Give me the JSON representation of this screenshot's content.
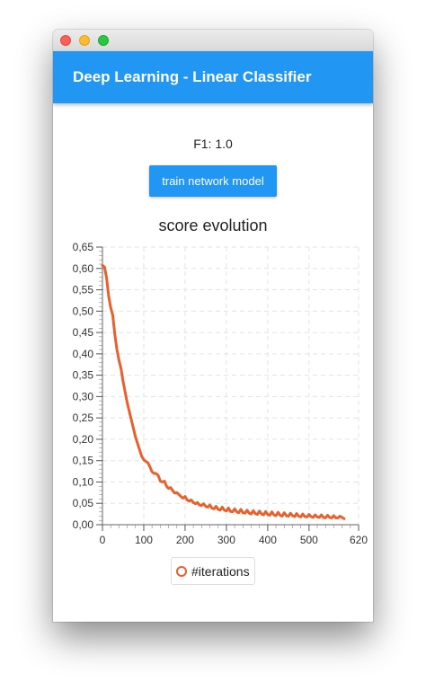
{
  "window": {
    "title": ""
  },
  "appbar": {
    "title": "Deep Learning - Linear Classifier"
  },
  "metric": {
    "f1_text": "F1: 1.0"
  },
  "actions": {
    "train_label": "train network model"
  },
  "colors": {
    "accent": "#2196f3",
    "series": "#e8612c",
    "grid": "#e3e3e3"
  },
  "chart_data": {
    "type": "line",
    "title": "score evolution",
    "xlabel": "",
    "ylabel": "",
    "xlim": [
      0,
      620
    ],
    "ylim": [
      0,
      0.65
    ],
    "x_ticks": [
      0,
      100,
      200,
      300,
      400,
      500,
      620
    ],
    "x_tick_labels": [
      "0",
      "100",
      "200",
      "300",
      "400",
      "500",
      "620"
    ],
    "y_ticks": [
      0,
      0.05,
      0.1,
      0.15,
      0.2,
      0.25,
      0.3,
      0.35,
      0.4,
      0.45,
      0.5,
      0.55,
      0.6,
      0.65
    ],
    "y_tick_labels": [
      "0,00",
      "0,05",
      "0,10",
      "0,15",
      "0,20",
      "0,25",
      "0,30",
      "0,35",
      "0,40",
      "0,45",
      "0,50",
      "0,55",
      "0,60",
      "0,65"
    ],
    "grid": true,
    "legend_position": "bottom",
    "series": [
      {
        "name": "#iterations",
        "x": [
          0,
          5,
          10,
          15,
          20,
          25,
          30,
          35,
          40,
          45,
          50,
          55,
          60,
          65,
          70,
          75,
          80,
          85,
          90,
          95,
          100,
          105,
          110,
          115,
          120,
          125,
          130,
          135,
          140,
          145,
          150,
          155,
          160,
          165,
          170,
          175,
          180,
          185,
          190,
          195,
          200,
          205,
          210,
          215,
          220,
          225,
          230,
          235,
          240,
          245,
          250,
          255,
          260,
          265,
          270,
          275,
          280,
          285,
          290,
          295,
          300,
          305,
          310,
          315,
          320,
          325,
          330,
          335,
          340,
          345,
          350,
          355,
          360,
          365,
          370,
          375,
          380,
          385,
          390,
          395,
          400,
          405,
          410,
          415,
          420,
          425,
          430,
          435,
          440,
          445,
          450,
          455,
          460,
          465,
          470,
          475,
          480,
          485,
          490,
          495,
          500,
          505,
          510,
          515,
          520,
          525,
          530,
          535,
          540,
          545,
          550,
          555,
          560,
          565,
          570,
          575,
          580,
          585
        ],
        "values": [
          0.607,
          0.603,
          0.578,
          0.535,
          0.508,
          0.49,
          0.445,
          0.41,
          0.385,
          0.365,
          0.335,
          0.31,
          0.285,
          0.265,
          0.245,
          0.225,
          0.205,
          0.19,
          0.175,
          0.16,
          0.152,
          0.148,
          0.145,
          0.135,
          0.124,
          0.12,
          0.12,
          0.115,
          0.102,
          0.1,
          0.102,
          0.09,
          0.085,
          0.087,
          0.08,
          0.074,
          0.075,
          0.071,
          0.066,
          0.062,
          0.066,
          0.058,
          0.055,
          0.058,
          0.052,
          0.049,
          0.052,
          0.046,
          0.045,
          0.049,
          0.043,
          0.041,
          0.046,
          0.039,
          0.037,
          0.043,
          0.036,
          0.034,
          0.041,
          0.034,
          0.032,
          0.039,
          0.031,
          0.03,
          0.037,
          0.03,
          0.028,
          0.036,
          0.028,
          0.027,
          0.034,
          0.027,
          0.025,
          0.033,
          0.026,
          0.024,
          0.032,
          0.025,
          0.023,
          0.031,
          0.024,
          0.022,
          0.03,
          0.023,
          0.021,
          0.029,
          0.022,
          0.02,
          0.028,
          0.021,
          0.02,
          0.027,
          0.021,
          0.019,
          0.026,
          0.02,
          0.018,
          0.025,
          0.019,
          0.018,
          0.024,
          0.019,
          0.017,
          0.023,
          0.018,
          0.017,
          0.023,
          0.017,
          0.016,
          0.022,
          0.017,
          0.016,
          0.021,
          0.016,
          0.016,
          0.02,
          0.017,
          0.014
        ]
      }
    ]
  }
}
